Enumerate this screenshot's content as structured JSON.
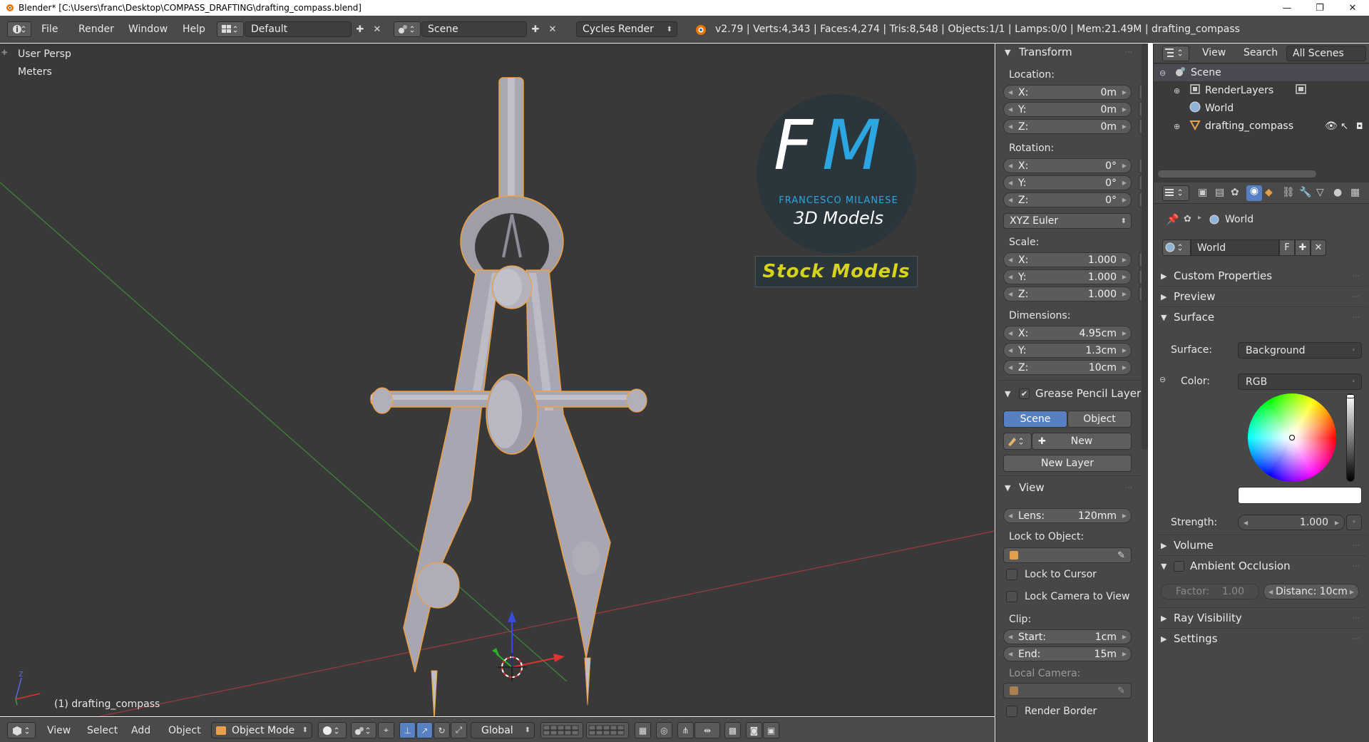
{
  "window": {
    "title": "Blender* [C:\\Users\\franc\\Desktop\\COMPASS_DRAFTING\\drafting_compass.blend]",
    "minimize": "—",
    "maximize": "❐",
    "close": "✕"
  },
  "topbar": {
    "menus": [
      "File",
      "Render",
      "Window",
      "Help"
    ],
    "screen_layout": "Default",
    "scene": "Scene",
    "render_engine": "Cycles Render",
    "stats": "v2.79 | Verts:4,343 | Faces:4,274 | Tris:8,548 | Objects:1/1 | Lamps:0/0 | Mem:21.49M | drafting_compass"
  },
  "viewport": {
    "view_name": "User Persp",
    "units": "Meters",
    "active_object": "(1) drafting_compass",
    "logo": {
      "letter_f": "F",
      "letter_m": "M",
      "author": "FRANCESCO MILANESE",
      "subtitle": "3D Models",
      "banner": "Stock Models"
    },
    "axis_z": "Z"
  },
  "bottombar": {
    "menus": [
      "View",
      "Select",
      "Add",
      "Object"
    ],
    "mode": "Object Mode",
    "orientation": "Global"
  },
  "npanel": {
    "transform": {
      "title": "Transform",
      "location_label": "Location:",
      "location": [
        {
          "axis": "X:",
          "value": "0m"
        },
        {
          "axis": "Y:",
          "value": "0m"
        },
        {
          "axis": "Z:",
          "value": "0m"
        }
      ],
      "rotation_label": "Rotation:",
      "rotation": [
        {
          "axis": "X:",
          "value": "0°"
        },
        {
          "axis": "Y:",
          "value": "0°"
        },
        {
          "axis": "Z:",
          "value": "0°"
        }
      ],
      "rotation_mode": "XYZ Euler",
      "scale_label": "Scale:",
      "scale": [
        {
          "axis": "X:",
          "value": "1.000"
        },
        {
          "axis": "Y:",
          "value": "1.000"
        },
        {
          "axis": "Z:",
          "value": "1.000"
        }
      ],
      "dimensions_label": "Dimensions:",
      "dimensions": [
        {
          "axis": "X:",
          "value": "4.95cm"
        },
        {
          "axis": "Y:",
          "value": "1.3cm"
        },
        {
          "axis": "Z:",
          "value": "10cm"
        }
      ]
    },
    "grease_pencil": {
      "title": "Grease Pencil Layer",
      "tab_scene": "Scene",
      "tab_object": "Object",
      "new_label": "New",
      "new_layer_label": "New Layer"
    },
    "view": {
      "title": "View",
      "lens_label": "Lens:",
      "lens_value": "120mm",
      "lock_to_object": "Lock to Object:",
      "lock_to_cursor": "Lock to Cursor",
      "lock_camera": "Lock Camera to View",
      "clip_label": "Clip:",
      "clip_start_label": "Start:",
      "clip_start_value": "1cm",
      "clip_end_label": "End:",
      "clip_end_value": "15m",
      "local_camera": "Local Camera:",
      "render_border": "Render Border"
    }
  },
  "outliner": {
    "menus": [
      "View",
      "Search"
    ],
    "filter": "All Scenes",
    "items": [
      {
        "label": "Scene"
      },
      {
        "label": "RenderLayers"
      },
      {
        "label": "World"
      },
      {
        "label": "drafting_compass"
      }
    ]
  },
  "properties": {
    "breadcrumb": "World",
    "world_name": "World",
    "fake_user": "F",
    "sections": {
      "custom_properties": "Custom Properties",
      "preview": "Preview",
      "surface": "Surface",
      "volume": "Volume",
      "ambient_occlusion": "Ambient Occlusion",
      "ray_visibility": "Ray Visibility",
      "settings": "Settings"
    },
    "surface_label": "Surface:",
    "surface_value": "Background",
    "color_label": "Color:",
    "color_value": "RGB",
    "strength_label": "Strength:",
    "strength_value": "1.000",
    "ao_factor_label": "Factor:",
    "ao_factor_value": "1.00",
    "ao_distance": "Distanc: 10cm",
    "color_swatch": "#ffffff"
  },
  "colors": {
    "accent_blue": "#5680c2",
    "logo_blue": "#2ca6e0",
    "banner_yellow": "#d6d31c",
    "outline_orange": "#f0a040"
  }
}
